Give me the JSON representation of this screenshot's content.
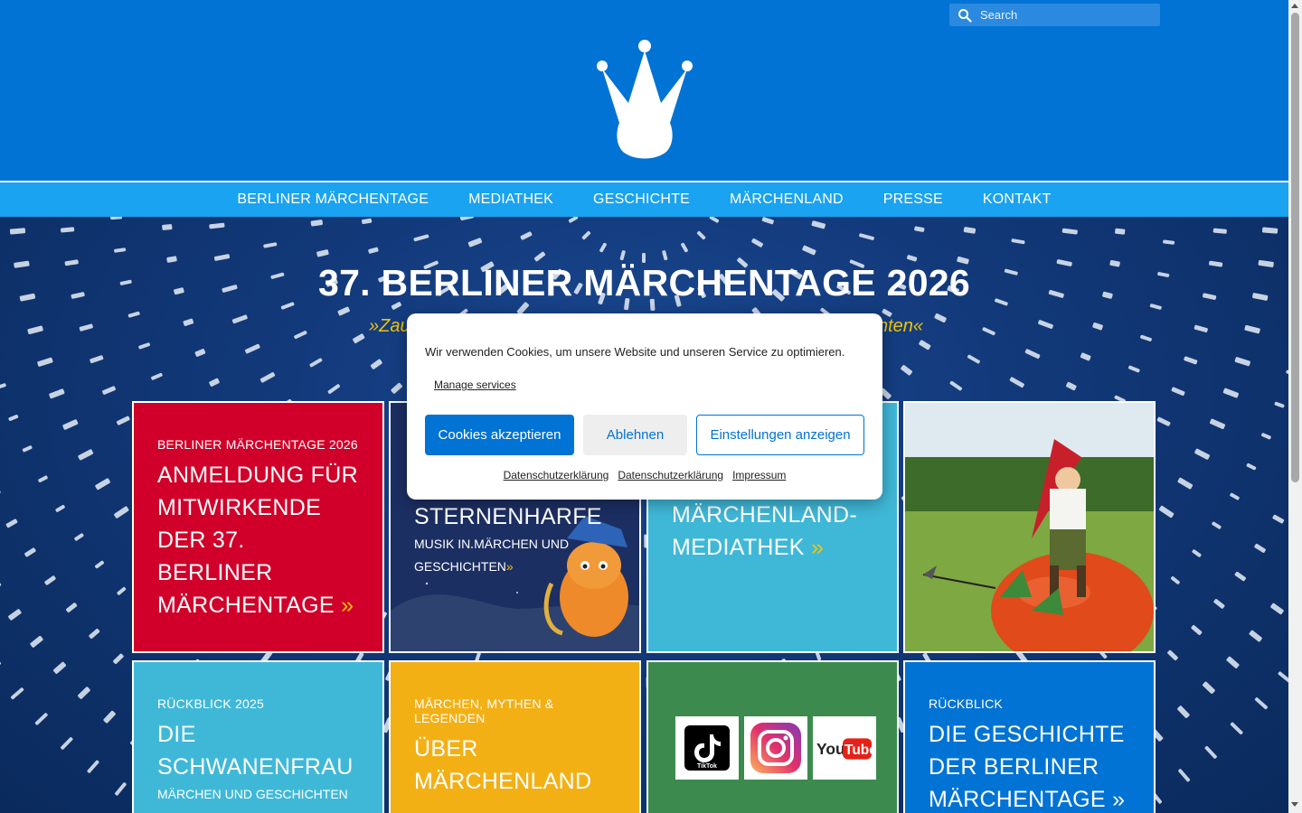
{
  "search": {
    "placeholder": "Search"
  },
  "nav": {
    "items": [
      {
        "label": "BERLINER MÄRCHENTAGE"
      },
      {
        "label": "MEDIATHEK"
      },
      {
        "label": "GESCHICHTE"
      },
      {
        "label": "MÄRCHENLAND"
      },
      {
        "label": "PRESSE"
      },
      {
        "label": "KONTAKT"
      }
    ]
  },
  "hero": {
    "title": "37. BERLINER MÄRCHENTAGE 2026",
    "subtitle_left": "»Zau",
    "subtitle_right": "nten«"
  },
  "tiles": [
    {
      "kicker": "BERLINER MÄRCHENTAGE 2026",
      "headline": "ANMELDUNG FÜR MITWIRKENDE DER 37. BERLINER MÄRCHENTAGE",
      "arrow": "»"
    },
    {
      "headline": "STERNENHARFE",
      "sub": "MUSIK IN MÄRCHEN UND GESCHICHTEN",
      "arrow": "»"
    },
    {
      "headline": "MÄRCHENLAND-MEDIATHEK",
      "arrow": "»"
    },
    {},
    {
      "kicker": "RÜCKBLICK 2025",
      "headline": "DIE SCHWANENFRAU",
      "sub": "MÄRCHEN UND GESCHICHTEN"
    },
    {
      "kicker": "MÄRCHEN, MYTHEN & LEGENDEN",
      "headline": "ÜBER MÄRCHENLAND"
    },
    {
      "social": [
        "TikTok",
        "Instagram",
        "YouTube"
      ]
    },
    {
      "kicker": "RÜCKBLICK",
      "headline": "DIE GESCHICHTE DER BERLINER MÄRCHENTAGE",
      "arrow": "»"
    }
  ],
  "cookie": {
    "message": "Wir verwenden Cookies, um unsere Website und unseren Service zu optimieren.",
    "manage": "Manage services",
    "accept": "Cookies akzeptieren",
    "deny": "Ablehnen",
    "settings": "Einstellungen anzeigen",
    "links": [
      "Datenschutzerklärung",
      "Datenschutzerklärung",
      "Impressum"
    ]
  },
  "colors": {
    "header_blue": "#0073d4",
    "nav_blue": "#1aa3f0",
    "accent_yellow": "#f5c400",
    "tile_red": "#d0002a",
    "tile_cyan": "#3fb8d8",
    "tile_yellow": "#f3b015",
    "tile_green": "#3d8a4e"
  }
}
